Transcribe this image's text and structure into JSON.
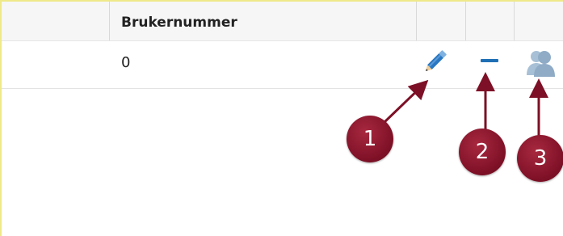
{
  "table": {
    "header": {
      "column_label": "Brukernummer"
    },
    "rows": [
      {
        "value": "0",
        "actions": [
          {
            "icon": "pencil-edit-icon",
            "label": ""
          },
          {
            "icon": "minus-remove-icon",
            "label": ""
          },
          {
            "icon": "users-icon",
            "label": ""
          }
        ]
      }
    ]
  },
  "callouts": [
    "1",
    "2",
    "3"
  ],
  "colors": {
    "border_accent": "#efe98a",
    "header_bg": "#f6f6f6",
    "action_blue": "#1f6fb5",
    "callout_red": "#7d1026"
  }
}
